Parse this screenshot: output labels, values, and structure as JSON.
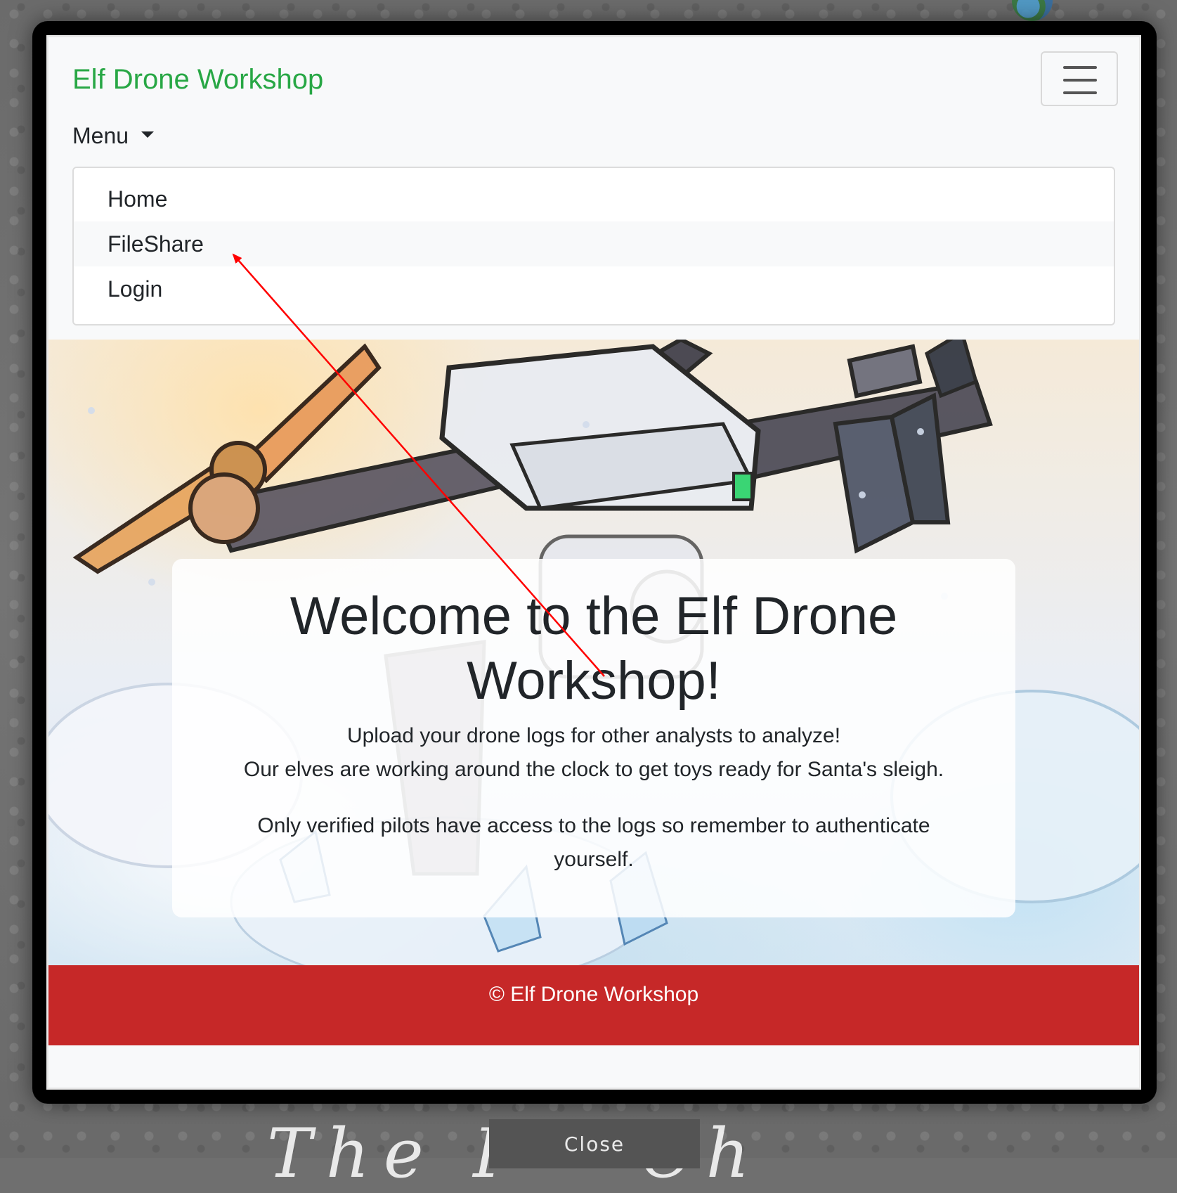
{
  "navbar": {
    "brand": "Elf Drone Workshop",
    "menu_label": "Menu",
    "menu_items": [
      {
        "label": "Home"
      },
      {
        "label": "FileShare"
      },
      {
        "label": "Login"
      }
    ]
  },
  "hero": {
    "title": "Welcome to the Elf Drone Workshop!",
    "lines": [
      "Upload your drone logs for other analysts to analyze!",
      "Our elves are working around the clock to get toys ready for Santa's sleigh.",
      "Only verified pilots have access to the logs so remember to authenticate yourself."
    ]
  },
  "footer": {
    "text": "© Elf Drone Workshop"
  },
  "modal": {
    "close_label": "Close"
  },
  "colors": {
    "brand": "#28a745",
    "footer": "#c62828",
    "annotation_arrow": "#ff0000"
  },
  "icons": {
    "toggler": "hamburger-icon",
    "menu": "caret-down-icon"
  }
}
